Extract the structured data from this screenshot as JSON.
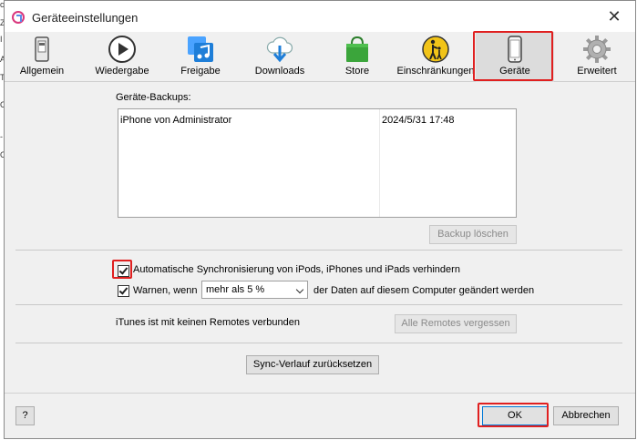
{
  "window": {
    "title": "Geräteeinstellungen"
  },
  "toolbar": {
    "items": [
      {
        "label": "Allgemein",
        "icon": "phone-switch-icon"
      },
      {
        "label": "Wiedergabe",
        "icon": "play-icon"
      },
      {
        "label": "Freigabe",
        "icon": "music-sharing-icon"
      },
      {
        "label": "Downloads",
        "icon": "cloud-download-icon"
      },
      {
        "label": "Store",
        "icon": "store-bag-icon"
      },
      {
        "label": "Einschränkungen",
        "icon": "restrictions-icon"
      },
      {
        "label": "Geräte",
        "icon": "device-icon"
      },
      {
        "label": "Erweitert",
        "icon": "gear-icon"
      }
    ],
    "selected": "Geräte"
  },
  "backups": {
    "label": "Geräte-Backups:",
    "rows": [
      {
        "name": "iPhone von Administrator",
        "date": "2024/5/31 17:48"
      }
    ],
    "delete_button": "Backup löschen"
  },
  "options": {
    "prevent_sync_label": "Automatische Synchronisierung von iPods, iPhones und iPads verhindern",
    "prevent_sync_checked": true,
    "warn_label_before": "Warnen, wenn",
    "warn_select_value": "mehr als 5 %",
    "warn_label_after": "der Daten auf diesem Computer geändert werden",
    "warn_checked": true
  },
  "remotes": {
    "status": "iTunes ist mit keinen Remotes verbunden",
    "forget_button": "Alle Remotes vergessen"
  },
  "sync_history_button": "Sync-Verlauf zurücksetzen",
  "footer": {
    "help_label": "?",
    "ok_label": "OK",
    "cancel_label": "Abbrechen"
  },
  "colors": {
    "highlight_red": "#e02020",
    "accent_blue": "#1e7ed8",
    "store_green": "#3ba53b",
    "restrict_yellow": "#f2c418"
  }
}
